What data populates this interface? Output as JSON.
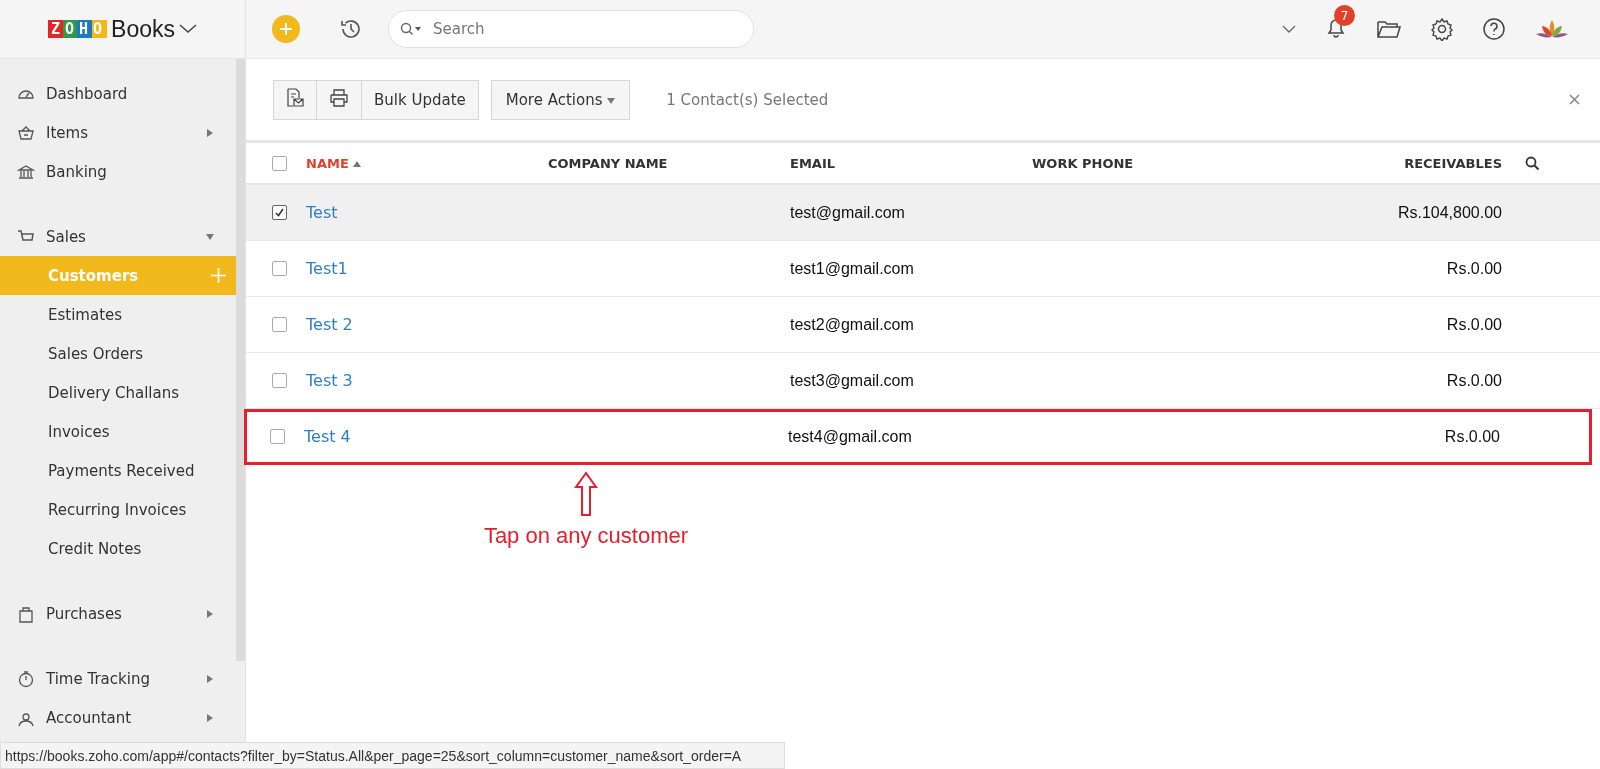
{
  "app": {
    "logo": "ZOHO",
    "name": "Books"
  },
  "topbar": {
    "search": {
      "placeholder": "Search"
    },
    "notifications": "7"
  },
  "sidebar": {
    "items": [
      {
        "label": "Dashboard",
        "kind": "section",
        "selected": false
      },
      {
        "label": "Items",
        "kind": "section",
        "selected": false,
        "expanded": false
      },
      {
        "label": "Banking",
        "kind": "section",
        "selected": false
      },
      {
        "label": "Sales",
        "kind": "section",
        "selected": false,
        "expanded": true,
        "children": [
          {
            "label": "Customers",
            "selected": true
          },
          {
            "label": "Estimates",
            "selected": false
          },
          {
            "label": "Sales Orders",
            "selected": false
          },
          {
            "label": "Delivery Challans",
            "selected": false
          },
          {
            "label": "Invoices",
            "selected": false
          },
          {
            "label": "Payments Received",
            "selected": false
          },
          {
            "label": "Recurring Invoices",
            "selected": false
          },
          {
            "label": "Credit Notes",
            "selected": false
          }
        ]
      },
      {
        "label": "Purchases",
        "kind": "section",
        "selected": false,
        "expanded": false
      },
      {
        "label": "Time Tracking",
        "kind": "section",
        "selected": false,
        "expanded": false
      },
      {
        "label": "Accountant",
        "kind": "section",
        "selected": false,
        "expanded": false
      }
    ]
  },
  "toolbar": {
    "bulk_update": "Bulk Update",
    "more_actions": "More Actions",
    "selection": "1 Contact(s) Selected"
  },
  "table": {
    "select_all": {
      "checked": false
    },
    "columns": [
      {
        "label": "NAME",
        "sorted": true
      },
      {
        "label": "COMPANY NAME",
        "sorted": false
      },
      {
        "label": "EMAIL",
        "sorted": false
      },
      {
        "label": "WORK PHONE",
        "sorted": false
      },
      {
        "label": "RECEIVABLES",
        "sorted": false
      }
    ],
    "rows": [
      {
        "name": "Test",
        "email": "test@gmail.com",
        "receivables": "Rs.104,800.00",
        "checked": true,
        "highlighted": false
      },
      {
        "name": "Test1",
        "email": "test1@gmail.com",
        "receivables": "Rs.0.00",
        "checked": false,
        "highlighted": false
      },
      {
        "name": "Test 2",
        "email": "test2@gmail.com",
        "receivables": "Rs.0.00",
        "checked": false,
        "highlighted": false
      },
      {
        "name": "Test 3",
        "email": "test3@gmail.com",
        "receivables": "Rs.0.00",
        "checked": false,
        "highlighted": false
      },
      {
        "name": "Test 4",
        "email": "test4@gmail.com",
        "receivables": "Rs.0.00",
        "checked": false,
        "highlighted": true
      }
    ]
  },
  "annotation": {
    "text": "Tap on any customer"
  },
  "status_bar": {
    "url": "https://books.zoho.com/app#/contacts?filter_by=Status.All&per_page=25&sort_column=customer_name&sort_order=A"
  }
}
